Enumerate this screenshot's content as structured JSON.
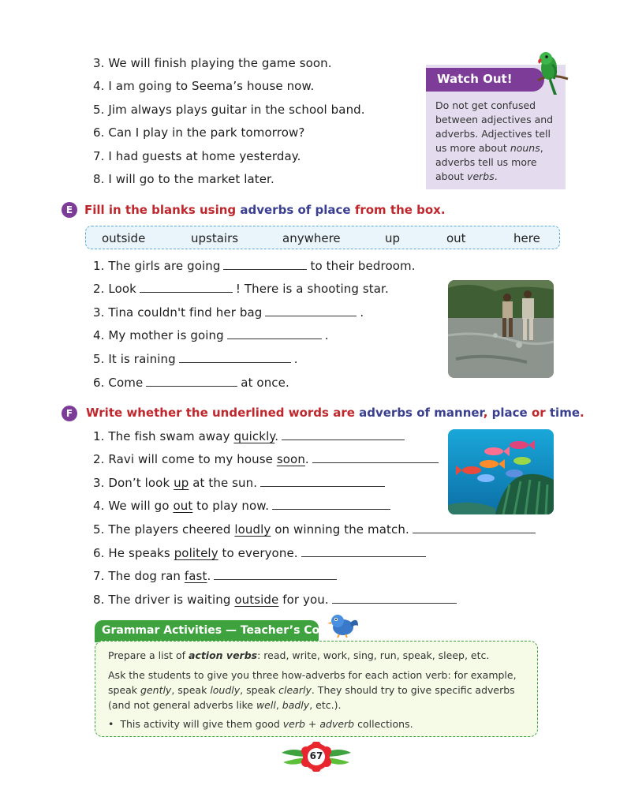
{
  "top_sentences": [
    "3. We will finish playing the game soon.",
    "4. I am going to Seema’s house now.",
    "5. Jim always plays guitar in the school band.",
    "6. Can I play in the park tomorrow?",
    "7. I had guests at home yesterday.",
    "8. I will go to the market later."
  ],
  "watch_out": {
    "title": "Watch Out!",
    "line1": "Do not get confused",
    "line2": "between adjectives and",
    "line3": "adverbs. Adjectives tell",
    "line4_a": "us more about ",
    "line4_b": "nouns",
    "line4_c": ",",
    "line5": "adverbs tell us more",
    "line6_a": "about ",
    "line6_b": "verbs",
    "line6_c": "."
  },
  "section_e": {
    "badge": "E",
    "title_a": "Fill in the blanks using ",
    "title_b": "adverbs of place",
    "title_c": " from the box.",
    "words": [
      "outside",
      "upstairs",
      "anywhere",
      "up",
      "out",
      "here"
    ],
    "items": [
      {
        "pre": "1. The girls are going",
        "post": "to their bedroom."
      },
      {
        "pre": "2. Look",
        "post": "! There is a shooting star."
      },
      {
        "pre": "3. Tina couldn't find her bag",
        "post": "."
      },
      {
        "pre": "4. My mother is going",
        "post": "."
      },
      {
        "pre": "5. It is raining",
        "post": "."
      },
      {
        "pre": "6. Come",
        "post": "at once."
      }
    ]
  },
  "section_f": {
    "badge": "F",
    "title_a": "Write whether the underlined words are ",
    "title_b": "adverbs of manner",
    "title_c": ", ",
    "title_d": "place",
    "title_e": " or ",
    "title_f": "time",
    "title_g": ".",
    "items": [
      {
        "pre": "1. The fish swam away ",
        "word": "quickly",
        "post": "."
      },
      {
        "pre": "2. Ravi will come to my house ",
        "word": "soon",
        "post": "."
      },
      {
        "pre": "3. Don’t look ",
        "word": "up",
        "post": " at the sun."
      },
      {
        "pre": "4. We will go ",
        "word": "out",
        "post": " to play now."
      },
      {
        "pre": "5. The players cheered ",
        "word": "loudly",
        "post": " on winning the match."
      },
      {
        "pre": "6. He speaks ",
        "word": "politely",
        "post": " to everyone."
      },
      {
        "pre": "7. The dog ran ",
        "word": "fast",
        "post": "."
      },
      {
        "pre": "8. The driver is waiting ",
        "word": "outside",
        "post": " for you."
      }
    ]
  },
  "teacher_corner": {
    "title": "Grammar Activities — Teacher’s Corner",
    "p1_a": "Prepare a list of ",
    "p1_b": "action verbs",
    "p1_c": ": read, write, work, sing, run, speak, sleep, etc.",
    "p2_l1": "Ask the students to give you three how-adverbs for each action verb: for example,",
    "p2_l2_a": "speak ",
    "p2_l2_b": "gently",
    "p2_l2_c": ", speak ",
    "p2_l2_d": "loudly",
    "p2_l2_e": ", speak ",
    "p2_l2_f": "clearly",
    "p2_l2_g": ". They should try to give specific adverbs",
    "p2_l3_a": "(and not general adverbs like ",
    "p2_l3_b": "well",
    "p2_l3_c": ", ",
    "p2_l3_d": "badly",
    "p2_l3_e": ", etc.).",
    "bullet": "•",
    "p3_a": "This activity will give them good ",
    "p3_b": "verb + adverb",
    "p3_c": " collections."
  },
  "page_number": "67",
  "colors": {
    "section_red": "#c0272d",
    "section_blue": "#3a3f8f",
    "badge_purple": "#7d3c98",
    "teacher_green": "#3ea33e"
  }
}
